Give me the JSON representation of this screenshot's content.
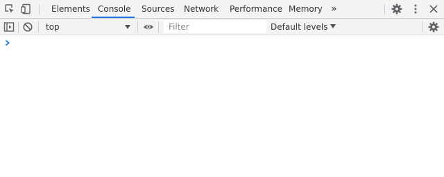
{
  "tabbar": {
    "tabs": [
      {
        "label": "Elements"
      },
      {
        "label": "Console"
      },
      {
        "label": "Sources"
      },
      {
        "label": "Network"
      },
      {
        "label": "Performance"
      },
      {
        "label": "Memory"
      }
    ],
    "active_tab": "Console",
    "more_tabs_glyph": "»",
    "icons": {
      "inspect": "inspect-element-icon",
      "device": "device-toolbar-icon",
      "settings": "gear-icon",
      "menu": "kebab-menu-icon",
      "close": "close-icon"
    }
  },
  "console_toolbar": {
    "context_value": "top",
    "filter_placeholder": "Filter",
    "levels_label": "Default levels",
    "icons": {
      "sidebar": "sidebar-toggle-icon",
      "clear": "clear-console-icon",
      "live_expression": "eye-icon",
      "settings": "gear-icon"
    }
  },
  "console": {
    "prompt_glyph": "›",
    "input_value": ""
  },
  "colors": {
    "toolbar_bg": "#f3f3f3",
    "active_tab_underline": "#1a73e8",
    "prompt_blue": "#1a73e8",
    "icon_gray": "#5f6368"
  }
}
